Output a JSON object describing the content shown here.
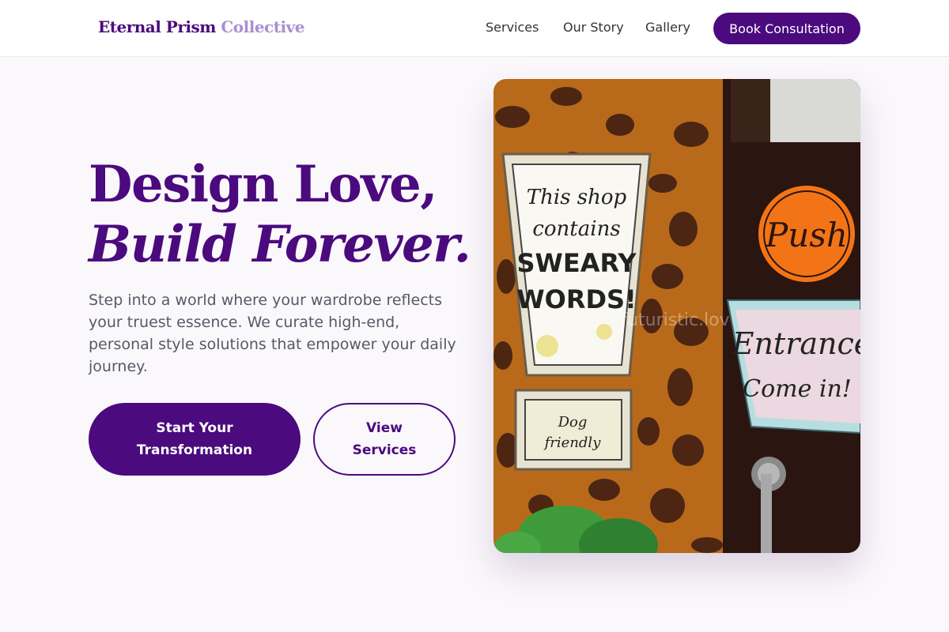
{
  "brand": {
    "name_part1": "Eternal Prism",
    "name_part2": "Collective"
  },
  "nav": {
    "links": [
      "Services",
      "Our Story",
      "Gallery"
    ],
    "cta_label": "Book Consultation"
  },
  "hero": {
    "title_line1": "Design Love,",
    "title_line2": "Build Forever.",
    "lead": "Step into a world where your wardrobe reflects your truest essence. We curate high-end, personal style solutions that empower your daily journey.",
    "primary_cta": "Start Your Transformation",
    "secondary_cta": "View Services"
  },
  "photo": {
    "sign_main": [
      "This shop",
      "contains",
      "SWEARY",
      "WORDS!"
    ],
    "sign_dog": [
      "Dog",
      "friendly"
    ],
    "sign_push": "Push",
    "sign_entrance": [
      "Entrance",
      "Come in!"
    ],
    "watermark": "futuristic.lov"
  },
  "colors": {
    "primary": "#4b0a7e",
    "logo_accent": "#a98fd0",
    "background": "#fbf8fc"
  }
}
